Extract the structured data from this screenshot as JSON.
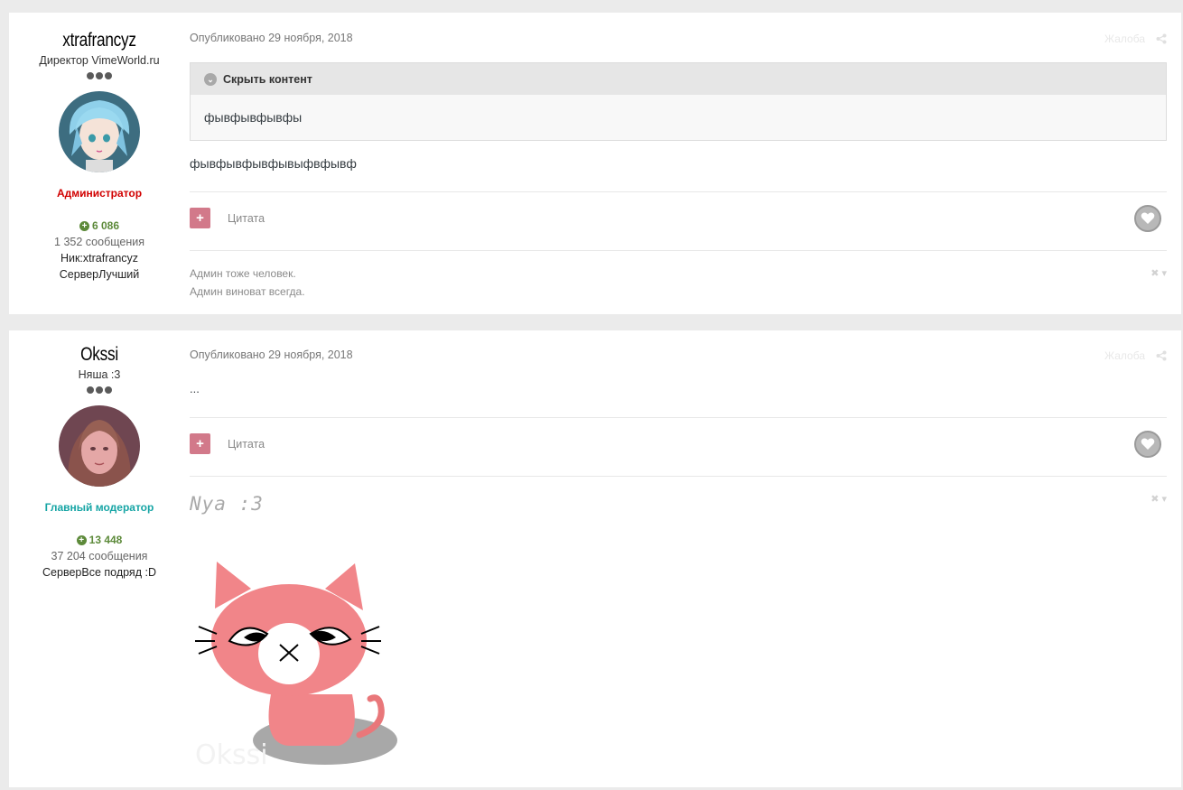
{
  "posts": [
    {
      "author": {
        "name": "xtrafrancyz",
        "title": "Директор VimeWorld.ru",
        "group": "Администратор",
        "group_color": "#d10000",
        "reputation": "6 086",
        "posts": "1 352 сообщения",
        "fields": [
          "Ник:xtrafrancyz",
          "СерверЛучший"
        ]
      },
      "date": "Опубликовано 29 ноября, 2018",
      "report": "Жалоба",
      "spoiler": {
        "title": "Скрыть контент",
        "content": "фывфывфывфы"
      },
      "body": "фывфывфывфывыфвфывф",
      "quote": "Цитата",
      "signature": [
        "Админ тоже человек.",
        "Админ виноват всегда."
      ]
    },
    {
      "author": {
        "name": "Okssi",
        "title": "Няша :3",
        "group": "Главный модератор",
        "group_color": "#17a5a5",
        "reputation": "13 448",
        "posts": "37 204 сообщения",
        "fields": [
          "СерверВсе подряд :D"
        ]
      },
      "date": "Опубликовано 29 ноября, 2018",
      "report": "Жалоба",
      "body": "...",
      "quote": "Цитата",
      "signature_text": "Nya :3",
      "signature_image_text": "Okssi"
    }
  ],
  "icons": {
    "plus": "+",
    "rep": "+",
    "chevron": "⌄",
    "close": "✖ ▾"
  }
}
